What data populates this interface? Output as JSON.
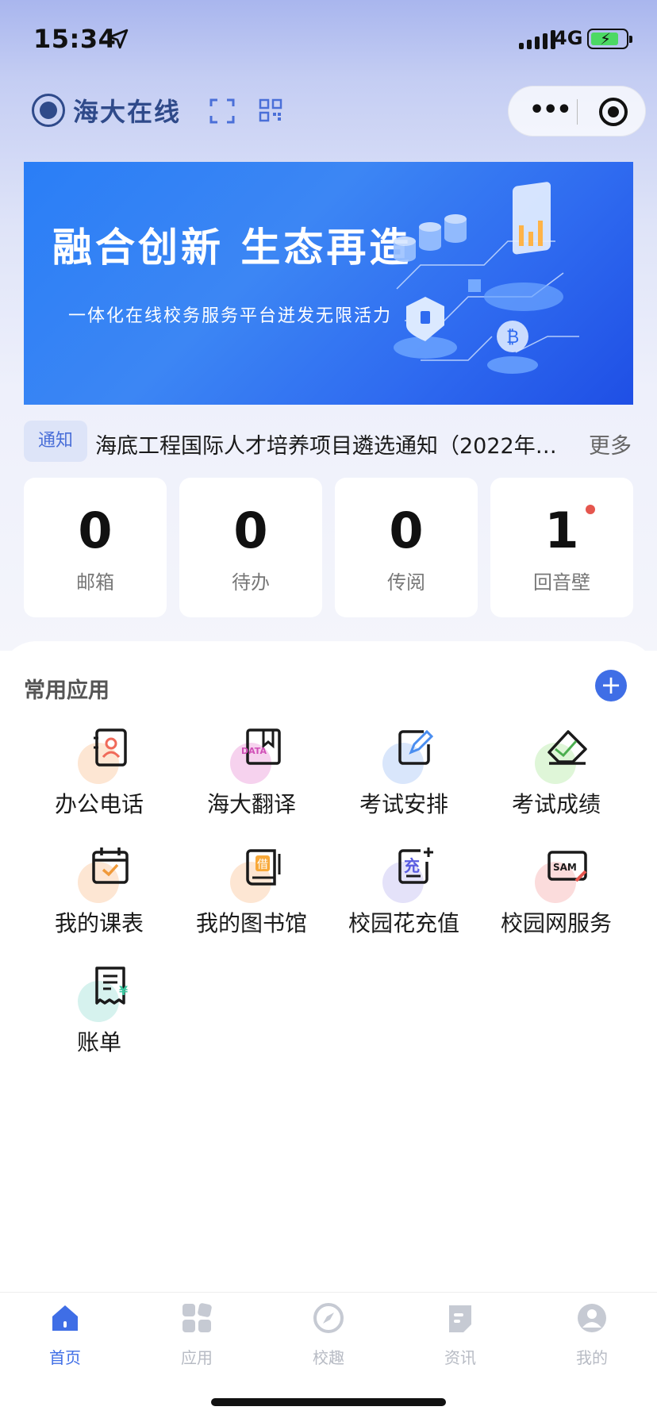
{
  "status_bar": {
    "time": "15:34",
    "network": "4G"
  },
  "header": {
    "app_name": "海大在线"
  },
  "banner": {
    "title": "融合创新  生态再造",
    "subtitle": "一体化在线校务服务平台迸发无限活力"
  },
  "notice": {
    "tag": "通知",
    "text": "海底工程国际人才培养项目遴选通知（2022年…",
    "more": "更多"
  },
  "stats": [
    {
      "value": "0",
      "label": "邮箱",
      "badge": false
    },
    {
      "value": "0",
      "label": "待办",
      "badge": false
    },
    {
      "value": "0",
      "label": "传阅",
      "badge": false
    },
    {
      "value": "1",
      "label": "回音壁",
      "badge": true
    }
  ],
  "apps": {
    "title": "常用应用",
    "add_label": "+",
    "items": [
      {
        "label": "办公电话",
        "icon": "contact-card-icon",
        "color": "#fde6d3"
      },
      {
        "label": "海大翻译",
        "icon": "translate-book-icon",
        "color": "#f6d2ee"
      },
      {
        "label": "考试安排",
        "icon": "edit-document-icon",
        "color": "#d9e6fb"
      },
      {
        "label": "考试成绩",
        "icon": "eraser-check-icon",
        "color": "#dff6d8"
      },
      {
        "label": "我的课表",
        "icon": "calendar-check-icon",
        "color": "#fde6d3"
      },
      {
        "label": "我的图书馆",
        "icon": "library-book-icon",
        "color": "#fde6d3"
      },
      {
        "label": "校园花充值",
        "icon": "recharge-icon",
        "color": "#e4e2f9"
      },
      {
        "label": "校园网服务",
        "icon": "network-service-icon",
        "color": "#fbdcdc"
      },
      {
        "label": "账单",
        "icon": "bill-receipt-icon",
        "color": "#d6f2ee"
      }
    ]
  },
  "tabbar": {
    "items": [
      {
        "label": "首页",
        "icon": "home-icon",
        "active": true
      },
      {
        "label": "应用",
        "icon": "apps-grid-icon",
        "active": false
      },
      {
        "label": "校趣",
        "icon": "compass-icon",
        "active": false
      },
      {
        "label": "资讯",
        "icon": "news-icon",
        "active": false
      },
      {
        "label": "我的",
        "icon": "profile-icon",
        "active": false
      }
    ]
  },
  "colors": {
    "accent": "#3f6ee6",
    "badge": "#e5564e"
  }
}
